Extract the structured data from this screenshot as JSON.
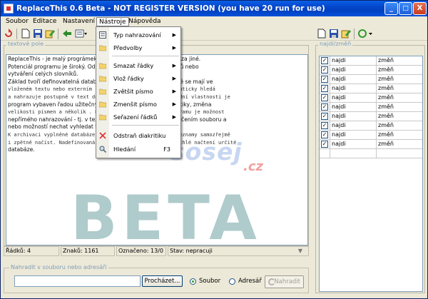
{
  "window": {
    "title": "ReplaceThis 0.6 Beta - NOT REGISTER VERSION (you have 20 run for use)",
    "minimize": "_",
    "maximize": "□",
    "close": "X"
  },
  "menubar": [
    "Soubor",
    "Editace",
    "Nastavení",
    "Nástroje",
    "Nápověda"
  ],
  "tools_menu": {
    "items": [
      {
        "label": "Typ nahrazování",
        "submenu": true
      },
      {
        "label": "Předvolby",
        "submenu": true
      },
      {
        "label": "Smazat řádky",
        "submenu": true
      },
      {
        "label": "Vlož řádky",
        "submenu": true
      },
      {
        "label": "Zvětšit písmo",
        "submenu": true
      },
      {
        "label": "Zmenšit písmo",
        "submenu": true
      },
      {
        "label": "Seřazení řádků",
        "submenu": true
      },
      {
        "label": "Odstraň diakritiku",
        "submenu": false
      },
      {
        "label": "Hledání",
        "shortcut": "F3",
        "submenu": false
      }
    ]
  },
  "text_panel": {
    "label": "textové pole",
    "lines": [
      "ReplaceThis - je malý prográmek                                          ebem nahrazování slov/znaků za jiné.",
      "Potenciál programu je široký. Od                                          komplexní úpravy různých kódů nebo",
      "vytváření celých slovníků.",
      "Základ tvoří definovatelná databáze                                         , sousloví nebo znaky, které se mají ve",
      "vloženém textu nebo externím s                                           seznamu slov program automaticky hledá",
      "a nahrazuje postupně v text                                             definovanými. Krom této základní vlastnosti je",
      "program vybaven řadou užitečných                                          ání prázdných řádků, diakritiky, změna",
      "velikosti písmen a několik                                              . Další zásadní vlastnost programu je možnost",
      "nepřímého nahrazování - tj. v tex                                         ml, ap.). To lze buď přímým určením souboru a",
      "nebo možností nechat vyhledat v                                          vem nebo koncovkou.",
      "K archivaci vyplněné databáze                                            rů .xml z kterého se dají seznamy samozřejmě",
      "i zpětně načíst. Nadefinovaná                                          , \"preset\" nastavení pro rychlé načtení určité",
      "databáze."
    ]
  },
  "watermark": {
    "sosej": "sosej",
    "cz": ".cz",
    "beta": "BETA"
  },
  "status": {
    "lines": "Řádků: 4",
    "chars": "Znaků: 1161",
    "selected": "Označeno: 13/0",
    "state": "Stav: nepracuji",
    "expander": "▼"
  },
  "replace_file": {
    "label": "Nahradit v souboru nebo adresáři",
    "path_value": "",
    "browse": "Procházet...",
    "opt_file": "Soubor",
    "opt_dir": "Adresář",
    "replace": "Nahradit"
  },
  "pairs_panel": {
    "label": "najdi/změň",
    "rows": [
      {
        "checked": "✓",
        "find": "najdi",
        "replace": "změň"
      },
      {
        "checked": "✓",
        "find": "najdi",
        "replace": "změň"
      },
      {
        "checked": "✓",
        "find": "najdi",
        "replace": "změň"
      },
      {
        "checked": "✓",
        "find": "najdi",
        "replace": "změň"
      },
      {
        "checked": "✓",
        "find": "najdi",
        "replace": "změň"
      },
      {
        "checked": "✓",
        "find": "najdi",
        "replace": "změň"
      },
      {
        "checked": "✓",
        "find": "najdi",
        "replace": "změň"
      },
      {
        "checked": "✓",
        "find": "najdi",
        "replace": "změň"
      },
      {
        "checked": "✓",
        "find": "najdi",
        "replace": "změň"
      },
      {
        "checked": "✓",
        "find": "najdi",
        "replace": "změň"
      },
      {
        "checked": "",
        "find": "",
        "replace": ""
      }
    ]
  },
  "colors": {
    "title_bar": "#0546C9",
    "window_bg": "#ECE9D8",
    "accent_red": "#D33333",
    "beta_watermark": "#6EA0A0"
  }
}
